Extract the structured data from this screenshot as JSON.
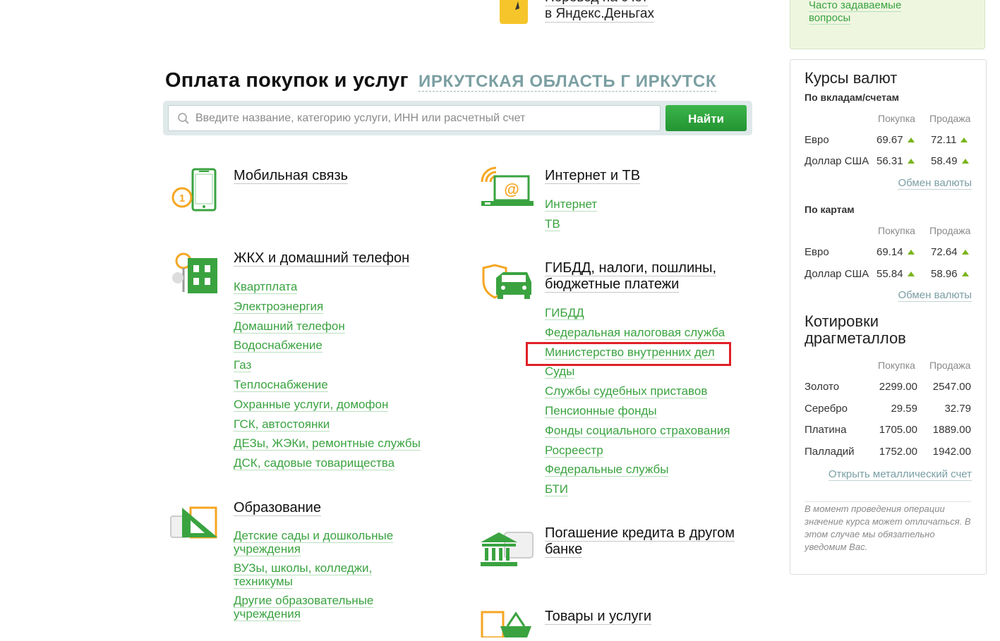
{
  "top_item": {
    "line1": "Перевод на счет",
    "line2": "в Яндекс.Деньгах",
    "icon": "yandex-wallet-icon"
  },
  "heading": {
    "title": "Оплата покупок и услуг",
    "region": "ИРКУТСКАЯ ОБЛАСТЬ Г ИРКУТСК"
  },
  "search": {
    "placeholder": "Введите название, категорию услуги, ИНН или расчетный счет",
    "value": "",
    "button": "Найти"
  },
  "categories": {
    "mobile": {
      "title": "Мобильная связь",
      "icon": "mobile-phone-icon"
    },
    "internet": {
      "title": "Интернет и ТВ",
      "icon": "laptop-wifi-icon",
      "links": [
        "Интернет",
        "ТВ"
      ]
    },
    "housing": {
      "title": "ЖКХ и домашний телефон",
      "icon": "building-tree-icon",
      "links": [
        "Квартплата",
        "Электроэнергия",
        "Домашний телефон",
        "Водоснабжение",
        "Газ",
        "Теплоснабжение",
        "Охранные услуги, домофон",
        "ГСК, автостоянки",
        "ДЕЗы, ЖЭКи, ремонтные службы",
        "ДСК, садовые товарищества"
      ]
    },
    "gibdd": {
      "title_line1": "ГИБДД, налоги, пошлины,",
      "title_line2": "бюджетные платежи",
      "icon": "car-shield-icon",
      "links": [
        "ГИБДД",
        "Федеральная налоговая служба",
        "Министерство внутренних дел",
        "Суды",
        "Службы судебных приставов",
        "Пенсионные фонды",
        "Фонды социального страхования",
        "Росреестр",
        "Федеральные службы",
        "БТИ"
      ]
    },
    "education": {
      "title": "Образование",
      "icon": "ruler-triangle-icon",
      "links": [
        {
          "l1": "Детские сады и дошкольные",
          "l2": "учреждения"
        },
        {
          "l1": "ВУЗы, школы, колледжи,",
          "l2": "техникумы"
        },
        {
          "l1": "Другие образовательные",
          "l2": "учреждения"
        }
      ]
    },
    "credit": {
      "title_line1": "Погашение кредита в другом",
      "title_line2": "банке",
      "icon": "bank-building-icon"
    },
    "goods": {
      "title": "Товары и услуги",
      "icon": "shopping-basket-icon"
    }
  },
  "sidebar": {
    "faq": {
      "line1": "Часто задаваемые",
      "line2": "вопросы"
    },
    "rates": {
      "title": "Курсы валют",
      "deposits": {
        "label": "По вкладам/счетам",
        "col_buy": "Покупка",
        "col_sell": "Продажа",
        "rows": [
          {
            "name": "Евро",
            "buy": "69.67",
            "sell": "72.11"
          },
          {
            "name": "Доллар США",
            "buy": "56.31",
            "sell": "58.49"
          }
        ],
        "link": "Обмен валюты"
      },
      "cards": {
        "label": "По картам",
        "col_buy": "Покупка",
        "col_sell": "Продажа",
        "rows": [
          {
            "name": "Евро",
            "buy": "69.14",
            "sell": "72.64"
          },
          {
            "name": "Доллар США",
            "buy": "55.84",
            "sell": "58.96"
          }
        ],
        "link": "Обмен валюты"
      }
    },
    "metals": {
      "title_line1": "Котировки",
      "title_line2": "драгметаллов",
      "col_buy": "Покупка",
      "col_sell": "Продажа",
      "rows": [
        {
          "name": "Золото",
          "buy": "2299.00",
          "sell": "2547.00"
        },
        {
          "name": "Серебро",
          "buy": "29.59",
          "sell": "32.79"
        },
        {
          "name": "Платина",
          "buy": "1705.00",
          "sell": "1889.00"
        },
        {
          "name": "Палладий",
          "buy": "1752.00",
          "sell": "1942.00"
        }
      ],
      "link": "Открыть металлический счет"
    },
    "note": "В момент проведения операции значение курса может отличаться. В этом случае мы обязательно уведомим Вас."
  },
  "colors": {
    "link_green": "#3aa340",
    "button_green": "#2ea53c",
    "region_teal": "#7b9fa2",
    "highlight_red": "#e01f27"
  }
}
